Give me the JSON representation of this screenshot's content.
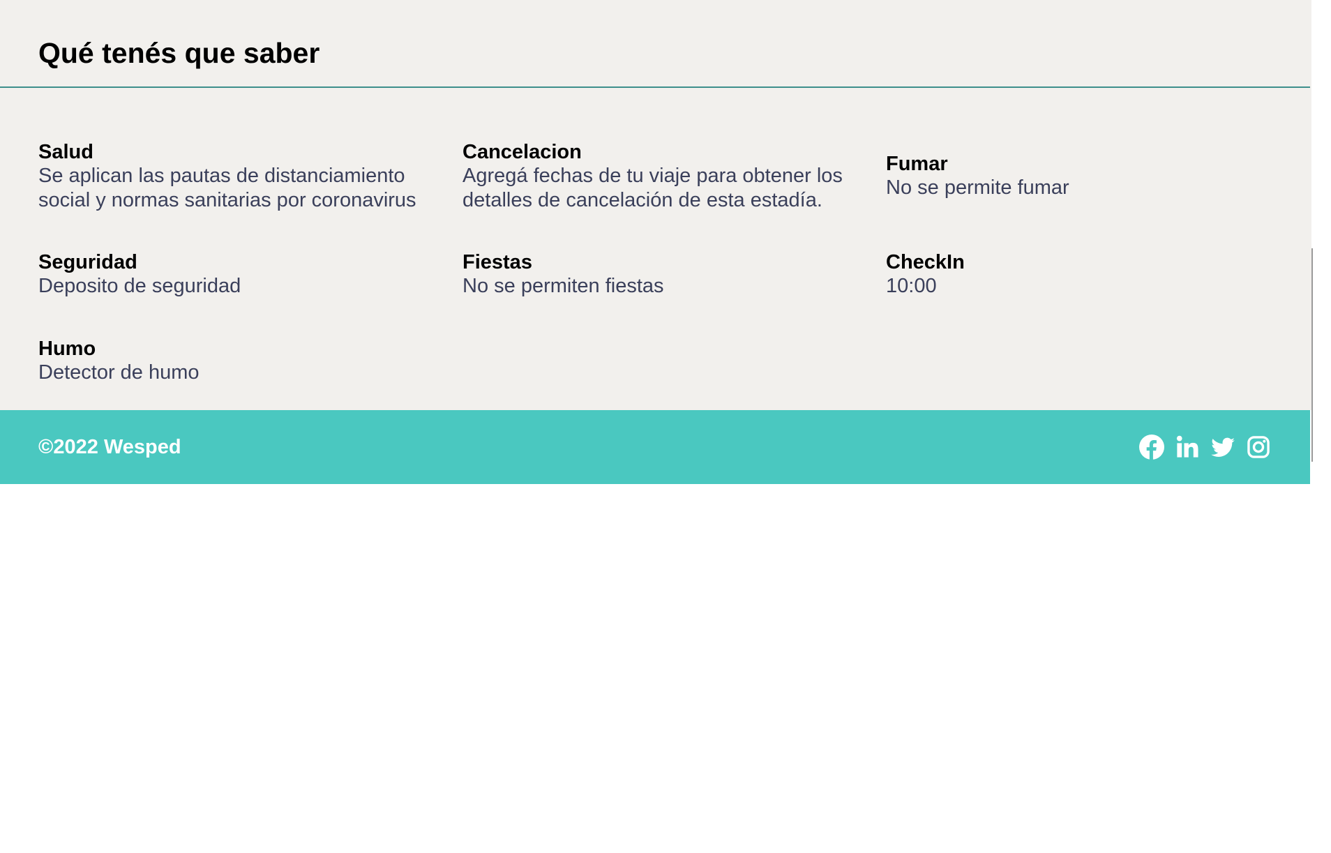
{
  "section": {
    "title": "Qué tenés que saber",
    "items": [
      {
        "title": "Salud",
        "desc": "Se aplican las pautas de distanciamiento social y normas sanitarias por coronavirus"
      },
      {
        "title": "Cancelacion",
        "desc": "Agregá fechas de tu viaje para obtener los detalles de cancelación de esta estadía."
      },
      {
        "title": "Fumar",
        "desc": "No se permite fumar"
      },
      {
        "title": "Seguridad",
        "desc": "Deposito de seguridad"
      },
      {
        "title": "Fiestas",
        "desc": "No se permiten fiestas"
      },
      {
        "title": "CheckIn",
        "desc": "10:00"
      },
      {
        "title": "Humo",
        "desc": "Detector de humo"
      }
    ]
  },
  "footer": {
    "copyright": "©2022 Wesped",
    "socials": [
      {
        "icon": "facebook-icon"
      },
      {
        "icon": "linkedin-icon"
      },
      {
        "icon": "twitter-icon"
      },
      {
        "icon": "instagram-icon"
      }
    ]
  },
  "colors": {
    "background": "#f2f0ed",
    "footer": "#4ac8c0",
    "divider": "#3d8f8b",
    "description_text": "#3a3f5a"
  }
}
